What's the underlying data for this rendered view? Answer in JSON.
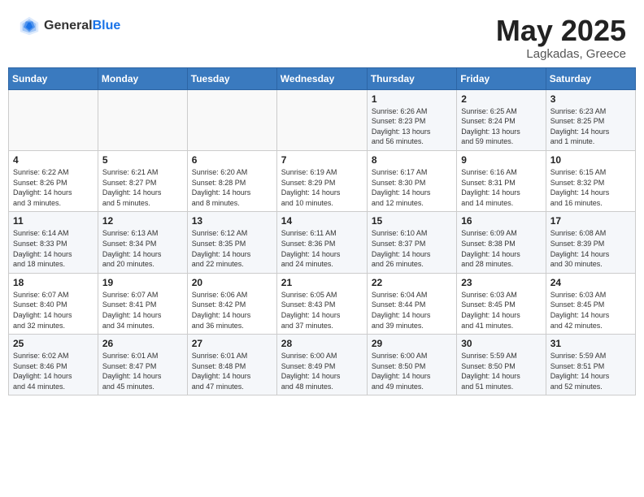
{
  "header": {
    "logo": {
      "general": "General",
      "blue": "Blue"
    },
    "title": "May 2025",
    "location": "Lagkadas, Greece"
  },
  "weekdays": [
    "Sunday",
    "Monday",
    "Tuesday",
    "Wednesday",
    "Thursday",
    "Friday",
    "Saturday"
  ],
  "weeks": [
    [
      {
        "day": "",
        "info": ""
      },
      {
        "day": "",
        "info": ""
      },
      {
        "day": "",
        "info": ""
      },
      {
        "day": "",
        "info": ""
      },
      {
        "day": "1",
        "info": "Sunrise: 6:26 AM\nSunset: 8:23 PM\nDaylight: 13 hours\nand 56 minutes."
      },
      {
        "day": "2",
        "info": "Sunrise: 6:25 AM\nSunset: 8:24 PM\nDaylight: 13 hours\nand 59 minutes."
      },
      {
        "day": "3",
        "info": "Sunrise: 6:23 AM\nSunset: 8:25 PM\nDaylight: 14 hours\nand 1 minute."
      }
    ],
    [
      {
        "day": "4",
        "info": "Sunrise: 6:22 AM\nSunset: 8:26 PM\nDaylight: 14 hours\nand 3 minutes."
      },
      {
        "day": "5",
        "info": "Sunrise: 6:21 AM\nSunset: 8:27 PM\nDaylight: 14 hours\nand 5 minutes."
      },
      {
        "day": "6",
        "info": "Sunrise: 6:20 AM\nSunset: 8:28 PM\nDaylight: 14 hours\nand 8 minutes."
      },
      {
        "day": "7",
        "info": "Sunrise: 6:19 AM\nSunset: 8:29 PM\nDaylight: 14 hours\nand 10 minutes."
      },
      {
        "day": "8",
        "info": "Sunrise: 6:17 AM\nSunset: 8:30 PM\nDaylight: 14 hours\nand 12 minutes."
      },
      {
        "day": "9",
        "info": "Sunrise: 6:16 AM\nSunset: 8:31 PM\nDaylight: 14 hours\nand 14 minutes."
      },
      {
        "day": "10",
        "info": "Sunrise: 6:15 AM\nSunset: 8:32 PM\nDaylight: 14 hours\nand 16 minutes."
      }
    ],
    [
      {
        "day": "11",
        "info": "Sunrise: 6:14 AM\nSunset: 8:33 PM\nDaylight: 14 hours\nand 18 minutes."
      },
      {
        "day": "12",
        "info": "Sunrise: 6:13 AM\nSunset: 8:34 PM\nDaylight: 14 hours\nand 20 minutes."
      },
      {
        "day": "13",
        "info": "Sunrise: 6:12 AM\nSunset: 8:35 PM\nDaylight: 14 hours\nand 22 minutes."
      },
      {
        "day": "14",
        "info": "Sunrise: 6:11 AM\nSunset: 8:36 PM\nDaylight: 14 hours\nand 24 minutes."
      },
      {
        "day": "15",
        "info": "Sunrise: 6:10 AM\nSunset: 8:37 PM\nDaylight: 14 hours\nand 26 minutes."
      },
      {
        "day": "16",
        "info": "Sunrise: 6:09 AM\nSunset: 8:38 PM\nDaylight: 14 hours\nand 28 minutes."
      },
      {
        "day": "17",
        "info": "Sunrise: 6:08 AM\nSunset: 8:39 PM\nDaylight: 14 hours\nand 30 minutes."
      }
    ],
    [
      {
        "day": "18",
        "info": "Sunrise: 6:07 AM\nSunset: 8:40 PM\nDaylight: 14 hours\nand 32 minutes."
      },
      {
        "day": "19",
        "info": "Sunrise: 6:07 AM\nSunset: 8:41 PM\nDaylight: 14 hours\nand 34 minutes."
      },
      {
        "day": "20",
        "info": "Sunrise: 6:06 AM\nSunset: 8:42 PM\nDaylight: 14 hours\nand 36 minutes."
      },
      {
        "day": "21",
        "info": "Sunrise: 6:05 AM\nSunset: 8:43 PM\nDaylight: 14 hours\nand 37 minutes."
      },
      {
        "day": "22",
        "info": "Sunrise: 6:04 AM\nSunset: 8:44 PM\nDaylight: 14 hours\nand 39 minutes."
      },
      {
        "day": "23",
        "info": "Sunrise: 6:03 AM\nSunset: 8:45 PM\nDaylight: 14 hours\nand 41 minutes."
      },
      {
        "day": "24",
        "info": "Sunrise: 6:03 AM\nSunset: 8:45 PM\nDaylight: 14 hours\nand 42 minutes."
      }
    ],
    [
      {
        "day": "25",
        "info": "Sunrise: 6:02 AM\nSunset: 8:46 PM\nDaylight: 14 hours\nand 44 minutes."
      },
      {
        "day": "26",
        "info": "Sunrise: 6:01 AM\nSunset: 8:47 PM\nDaylight: 14 hours\nand 45 minutes."
      },
      {
        "day": "27",
        "info": "Sunrise: 6:01 AM\nSunset: 8:48 PM\nDaylight: 14 hours\nand 47 minutes."
      },
      {
        "day": "28",
        "info": "Sunrise: 6:00 AM\nSunset: 8:49 PM\nDaylight: 14 hours\nand 48 minutes."
      },
      {
        "day": "29",
        "info": "Sunrise: 6:00 AM\nSunset: 8:50 PM\nDaylight: 14 hours\nand 49 minutes."
      },
      {
        "day": "30",
        "info": "Sunrise: 5:59 AM\nSunset: 8:50 PM\nDaylight: 14 hours\nand 51 minutes."
      },
      {
        "day": "31",
        "info": "Sunrise: 5:59 AM\nSunset: 8:51 PM\nDaylight: 14 hours\nand 52 minutes."
      }
    ]
  ]
}
